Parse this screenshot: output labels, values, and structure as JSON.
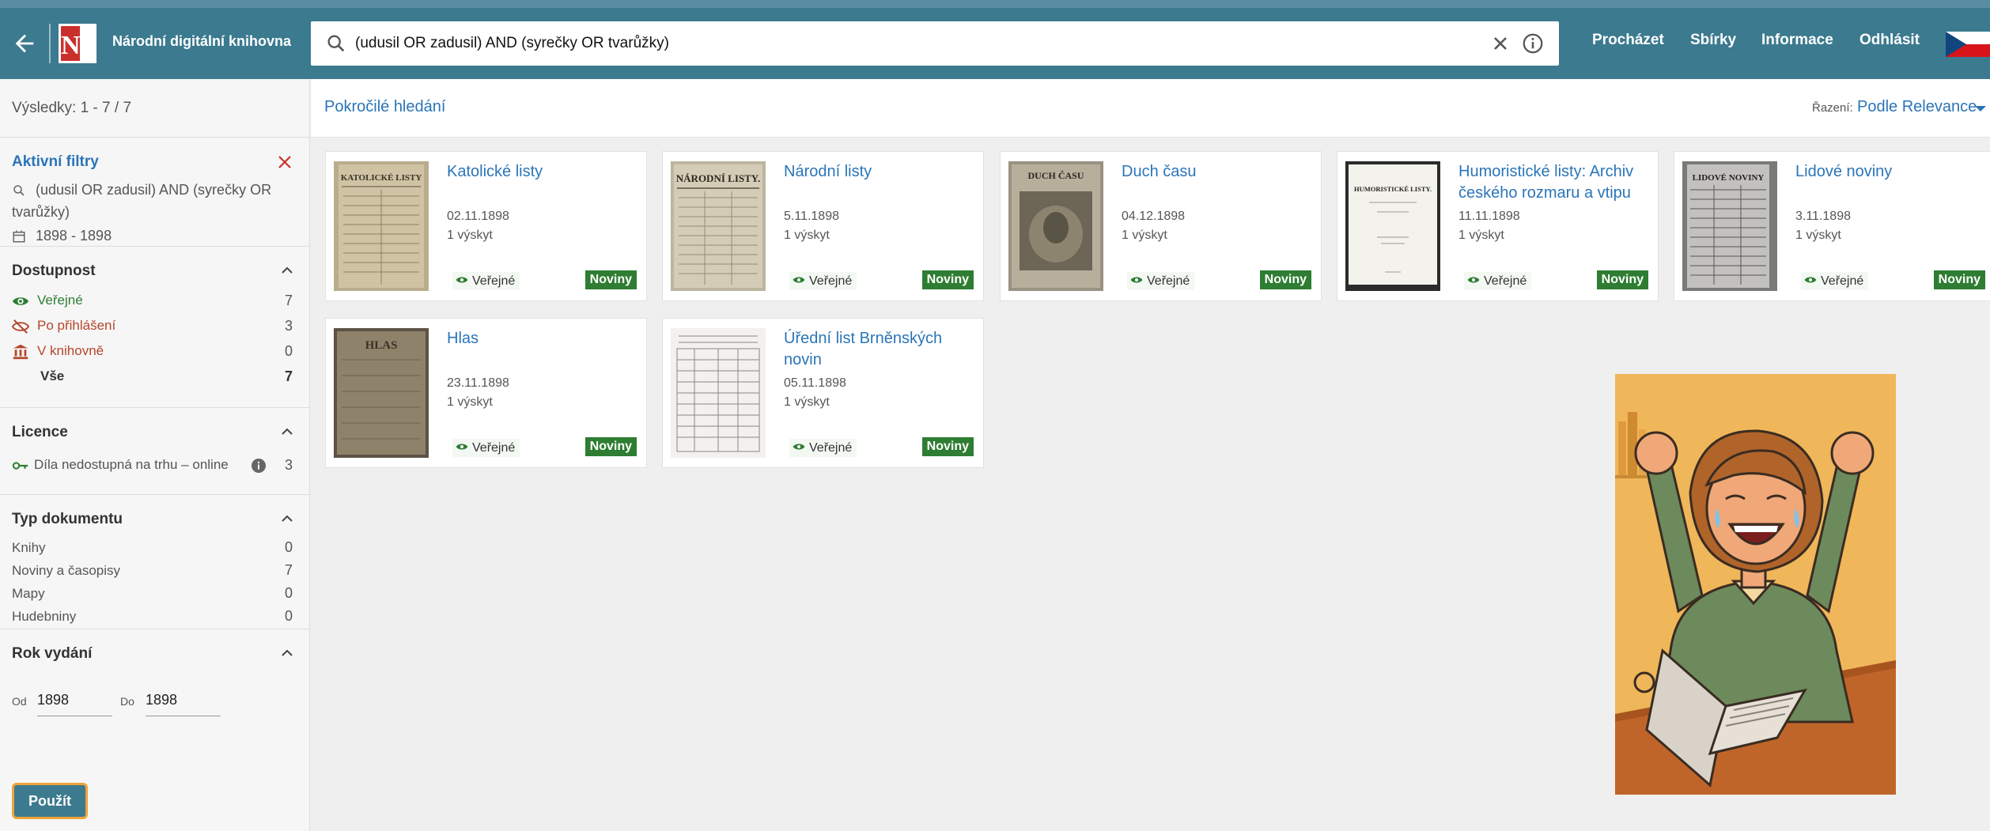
{
  "header": {
    "brand": "Národní digitální knihovna",
    "logo_text": "NK",
    "search": {
      "value": "(udusil OR zadusil) AND (syrečky OR tvarůžky)"
    },
    "nav": [
      "Procházet",
      "Sbírky",
      "Informace",
      "Odhlásit"
    ]
  },
  "sidebar": {
    "results": "Výsledky: 1 - 7 / 7",
    "active_filters": {
      "title": "Aktivní filtry",
      "query": "(udusil OR zadusil) AND (syrečky OR tvarůžky)",
      "years": "1898 - 1898"
    },
    "availability": {
      "title": "Dostupnost",
      "items": [
        {
          "label": "Veřejné",
          "count": "7"
        },
        {
          "label": "Po přihlášení",
          "count": "3"
        },
        {
          "label": "V knihovně",
          "count": "0"
        },
        {
          "label": "Vše",
          "count": "7"
        }
      ]
    },
    "license": {
      "title": "Licence",
      "items": [
        {
          "label": "Díla nedostupná na trhu – online",
          "count": "3"
        }
      ]
    },
    "doc_type": {
      "title": "Typ dokumentu",
      "items": [
        {
          "label": "Knihy",
          "count": "0"
        },
        {
          "label": "Noviny a časopisy",
          "count": "7"
        },
        {
          "label": "Mapy",
          "count": "0"
        },
        {
          "label": "Hudebniny",
          "count": "0"
        }
      ]
    },
    "year": {
      "title": "Rok vydání",
      "from_label": "Od",
      "from": "1898",
      "to_label": "Do",
      "to": "1898",
      "apply": "Použít"
    }
  },
  "main": {
    "advanced": "Pokročilé hledání",
    "sort_label": "Řazení:",
    "sort_value": "Podle Relevance",
    "cards": [
      {
        "title": "Katolické listy",
        "masthead": "KATOLICKÉ LISTY",
        "date": "02.11.1898",
        "hits": "1 výskyt",
        "access": "Veřejné",
        "type": "Noviny"
      },
      {
        "title": "Národní listy",
        "masthead": "NÁRODNÍ LISTY.",
        "date": "5.11.1898",
        "hits": "1 výskyt",
        "access": "Veřejné",
        "type": "Noviny"
      },
      {
        "title": "Duch času",
        "masthead": "DUCH ČASU",
        "date": "04.12.1898",
        "hits": "1 výskyt",
        "access": "Veřejné",
        "type": "Noviny"
      },
      {
        "title": "Humoristické listy: Archiv českého rozmaru a vtipu",
        "masthead": "HUMORISTICKÉ LISTY.",
        "date": "11.11.1898",
        "hits": "1 výskyt",
        "access": "Veřejné",
        "type": "Noviny"
      },
      {
        "title": "Lidové noviny",
        "masthead": "LIDOVÉ NOVINY",
        "date": "3.11.1898",
        "hits": "1 výskyt",
        "access": "Veřejné",
        "type": "Noviny"
      },
      {
        "title": "Hlas",
        "masthead": "HLAS",
        "date": "23.11.1898",
        "hits": "1 výskyt",
        "access": "Veřejné",
        "type": "Noviny"
      },
      {
        "title": "Úřední list Brněnských novin",
        "masthead": "",
        "date": "05.11.1898",
        "hits": "1 výskyt",
        "access": "Veřejné",
        "type": "Noviny"
      }
    ]
  },
  "colors": {
    "header": "#3b7a8f",
    "link": "#2b75b8",
    "public": "#2e7d32",
    "restricted": "#b4462b",
    "illustration_bg": "#f0b65a"
  }
}
